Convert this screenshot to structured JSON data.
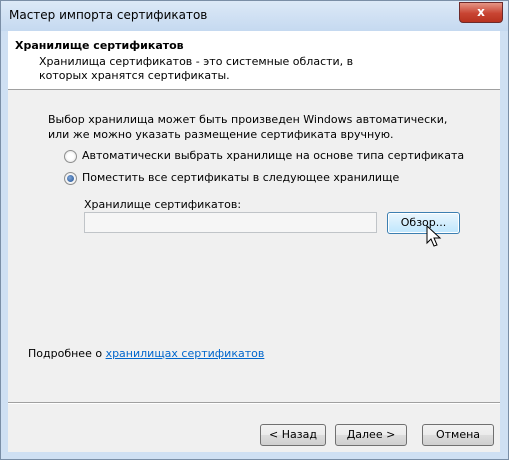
{
  "window": {
    "title": "Мастер импорта сертификатов",
    "close_glyph": "x"
  },
  "header": {
    "title": "Хранилище сертификатов",
    "description": "Хранилища сертификатов - это системные области, в которых хранятся сертификаты."
  },
  "main": {
    "intro": "Выбор хранилища может быть произведен Windows автоматически, или же можно указать размещение сертификата вручную.",
    "options": [
      {
        "label": "Автоматически выбрать хранилище на основе типа сертификата",
        "selected": false
      },
      {
        "label": "Поместить все сертификаты в следующее хранилище",
        "selected": true
      }
    ],
    "store_label": "Хранилище сертификатов:",
    "store_value": "",
    "browse_label": "Обзор...",
    "more_info_prefix": "Подробнее о ",
    "more_info_link": "хранилищах сертификатов"
  },
  "footer": {
    "back_label": "< Назад",
    "next_label": "Далее >",
    "cancel_label": "Отмена"
  },
  "icons": {
    "close": "close-icon",
    "cursor": "mouse-pointer-icon"
  }
}
